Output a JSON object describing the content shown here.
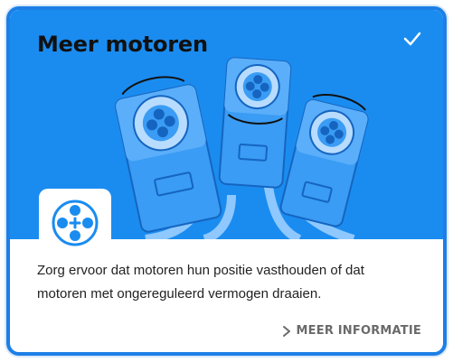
{
  "card": {
    "title": "Meer motoren",
    "description": "Zorg ervoor dat motoren hun positie vasthouden of dat motoren met ongereguleerd vermogen draaien.",
    "more_label": "MEER INFORMATIE",
    "selected_icon": "checkmark-icon",
    "badge_icon": "motor-hub-icon",
    "more_icon": "chevron-right-icon"
  },
  "colors": {
    "accent": "#1a8cf0",
    "border": "#1d7fe6",
    "motor_body": "#3a9cf4",
    "motor_light": "#b8dcff",
    "motor_dark": "#1565c0"
  }
}
